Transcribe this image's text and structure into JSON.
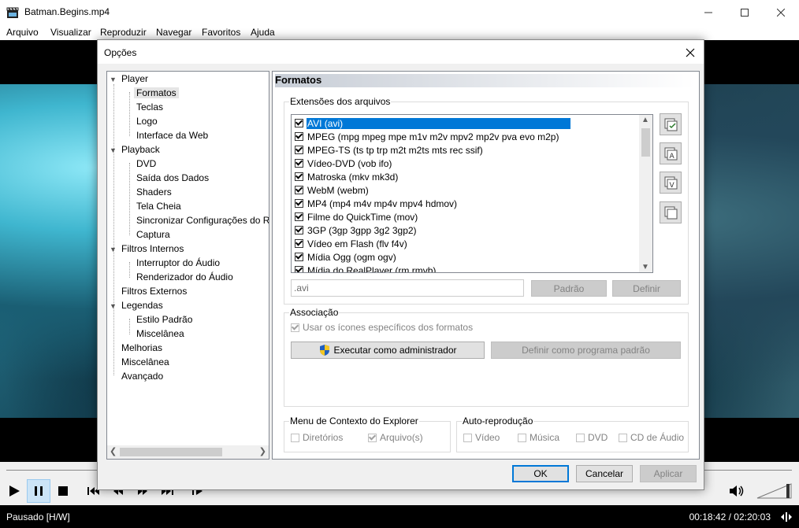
{
  "window": {
    "title": "Batman.Begins.mp4",
    "menu": [
      "Arquivo",
      "Visualizar",
      "Reproduzir",
      "Navegar",
      "Favoritos",
      "Ajuda"
    ]
  },
  "status": {
    "state": "Pausado [H/W]",
    "time": "00:18:42 / 02:20:03"
  },
  "dialog": {
    "title": "Opções",
    "tree": {
      "player": "Player",
      "formatos": "Formatos",
      "teclas": "Teclas",
      "logo": "Logo",
      "interface_web": "Interface da Web",
      "playback": "Playback",
      "dvd": "DVD",
      "saida_dados": "Saída dos Dados",
      "shaders": "Shaders",
      "tela_cheia": "Tela Cheia",
      "sincronizar": "Sincronizar Configurações do R",
      "captura": "Captura",
      "filtros_internos": "Filtros Internos",
      "interruptor_audio": "Interruptor do Áudio",
      "renderizador_audio": "Renderizador do Áudio",
      "filtros_externos": "Filtros Externos",
      "legendas": "Legendas",
      "estilo_padrao": "Estilo Padrão",
      "miscelanea_leg": "Miscelânea",
      "melhorias": "Melhorias",
      "miscelanea": "Miscelânea",
      "avancado": "Avançado"
    },
    "panel_title": "Formatos",
    "extensions_group": "Extensões dos arquivos",
    "formats": [
      {
        "label": "AVI (avi)",
        "checked": true
      },
      {
        "label": "MPEG (mpg mpeg mpe m1v m2v mpv2 mp2v pva evo m2p)",
        "checked": true
      },
      {
        "label": "MPEG-TS (ts tp trp m2t m2ts mts rec ssif)",
        "checked": true
      },
      {
        "label": "Vídeo-DVD (vob ifo)",
        "checked": true
      },
      {
        "label": "Matroska (mkv mk3d)",
        "checked": true
      },
      {
        "label": "WebM (webm)",
        "checked": true
      },
      {
        "label": "MP4 (mp4 m4v mp4v mpv4 hdmov)",
        "checked": true
      },
      {
        "label": "Filme do QuickTime (mov)",
        "checked": true
      },
      {
        "label": "3GP (3gp 3gpp 3g2 3gp2)",
        "checked": true
      },
      {
        "label": "Vídeo em Flash (flv f4v)",
        "checked": true
      },
      {
        "label": "Mídia Ogg (ogm ogv)",
        "checked": true
      },
      {
        "label": "Mídia do RealPlayer (rm rmvb)",
        "checked": true
      }
    ],
    "ext_input_value": ".avi",
    "btn_padrao": "Padrão",
    "btn_definir": "Definir",
    "association_group": "Associação",
    "use_icons_label": "Usar os ícones específicos dos formatos",
    "btn_run_admin": "Executar como administrador",
    "btn_set_default": "Definir como programa padrão",
    "context_menu_group": "Menu de Contexto do Explorer",
    "ctx_dirs": "Diretórios",
    "ctx_files": "Arquivo(s)",
    "autoplay_group": "Auto-reprodução",
    "ap_video": "Vídeo",
    "ap_music": "Música",
    "ap_dvd": "DVD",
    "ap_cd": "CD de Áudio",
    "btn_ok": "OK",
    "btn_cancel": "Cancelar",
    "btn_apply": "Aplicar"
  },
  "colors": {
    "selection": "#0078d7",
    "status_bg": "#000000"
  }
}
